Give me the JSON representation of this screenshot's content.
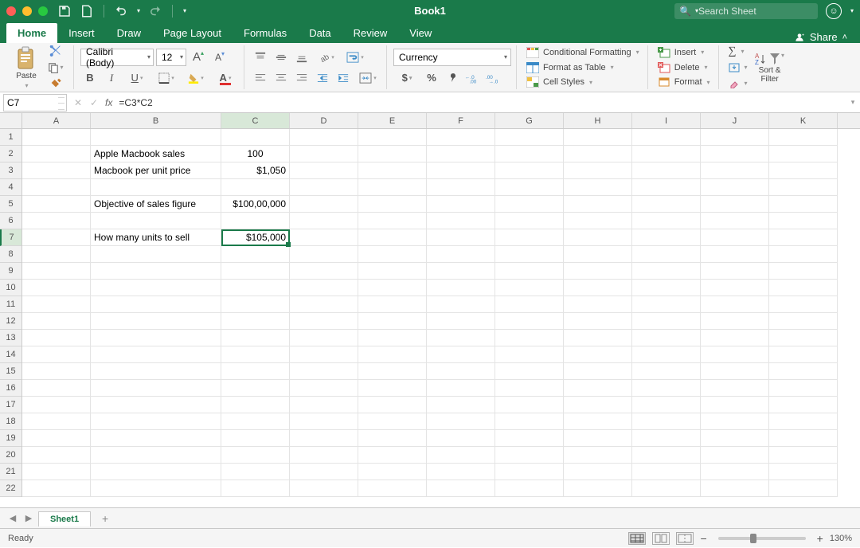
{
  "title": "Book1",
  "search_placeholder": "Search Sheet",
  "tabs": {
    "home": "Home",
    "insert": "Insert",
    "draw": "Draw",
    "layout": "Page Layout",
    "formulas": "Formulas",
    "data": "Data",
    "review": "Review",
    "view": "View"
  },
  "share": "Share",
  "ribbon": {
    "paste": "Paste",
    "font_name": "Calibri (Body)",
    "font_size": "12",
    "number_format": "Currency",
    "cf": "Conditional Formatting",
    "fat": "Format as Table",
    "cs": "Cell Styles",
    "insert": "Insert",
    "delete": "Delete",
    "format": "Format",
    "sort": "Sort & Filter"
  },
  "namebox": "C7",
  "fx": "fx",
  "formula": "=C3*C2",
  "columns": [
    "A",
    "B",
    "C",
    "D",
    "E",
    "F",
    "G",
    "H",
    "I",
    "J",
    "K"
  ],
  "rows": 22,
  "cells": {
    "B2": "Apple Macbook sales",
    "C2": "100",
    "B3": "Macbook per unit price",
    "C3": "$1,050",
    "B5": "Objective of sales figure",
    "C5": "$100,00,000",
    "B7": "How many units to sell",
    "C7": "$105,000"
  },
  "selected": "C7",
  "sheet": "Sheet1",
  "status": "Ready",
  "zoom": "130%"
}
